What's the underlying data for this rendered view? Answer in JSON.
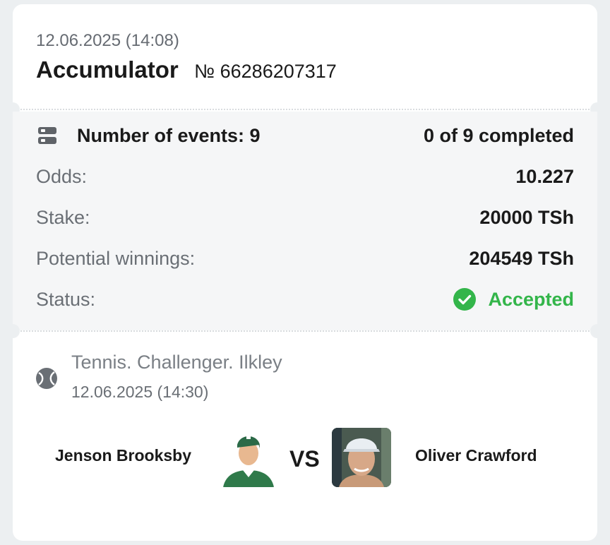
{
  "bet": {
    "datetime": "12.06.2025 (14:08)",
    "type": "Accumulator",
    "number": "№ 66286207317"
  },
  "summary": {
    "events_label": "Number of events: 9",
    "events_progress": "0 of 9 completed",
    "odds_label": "Odds:",
    "odds_value": "10.227",
    "stake_label": "Stake:",
    "stake_value": "20000 TSh",
    "winnings_label": "Potential winnings:",
    "winnings_value": "204549 TSh",
    "status_label": "Status:",
    "status_value": "Accepted"
  },
  "event": {
    "sport_icon": "tennis-ball-icon",
    "tournament": "Tennis. Challenger. Ilkley",
    "datetime": "12.06.2025 (14:30)",
    "team1": "Jenson Brooksby",
    "vs": "VS",
    "team2": "Oliver Crawford"
  },
  "colors": {
    "accent_green": "#33b54a",
    "text_dark": "#1a1a1a",
    "text_muted": "#6a6f75",
    "summary_bg": "#f5f6f7",
    "page_bg": "#eceff1"
  }
}
